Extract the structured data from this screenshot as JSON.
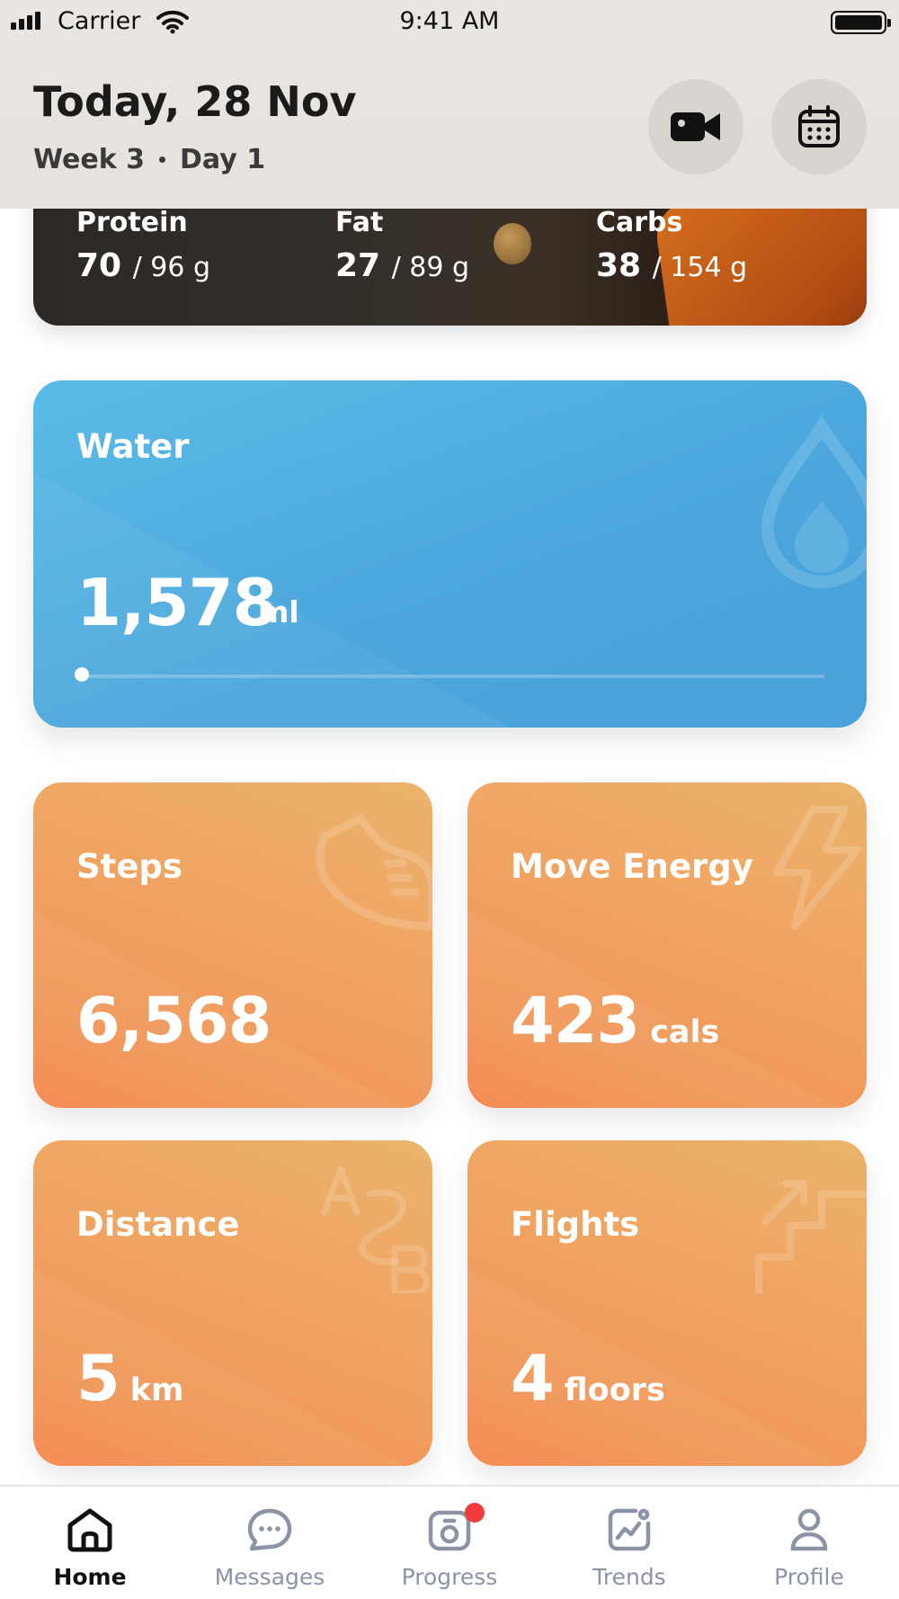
{
  "status_bar": {
    "carrier": "Carrier",
    "time": "9:41 AM",
    "icons": [
      "signal-icon",
      "wifi-icon",
      "battery-icon"
    ]
  },
  "header": {
    "title": "Today, 28 Nov",
    "week": "Week 3",
    "day": "Day 1",
    "buttons": [
      "video-camera-icon",
      "calendar-icon"
    ]
  },
  "macros": [
    {
      "label": "Protein",
      "value": "70",
      "target": "/ 96 g"
    },
    {
      "label": "Fat",
      "value": "27",
      "target": "/ 89 g"
    },
    {
      "label": "Carbs",
      "value": "38",
      "target": "/ 154 g"
    }
  ],
  "water": {
    "label": "Water",
    "value": "1,578",
    "unit": "ml",
    "progress": 0.0,
    "icon": "water-drop-icon"
  },
  "tiles": {
    "steps": {
      "label": "Steps",
      "value": "6,568",
      "unit": "",
      "icon": "sneaker-icon"
    },
    "move_energy": {
      "label": "Move Energy",
      "value": "423",
      "unit": "cals",
      "icon": "lightning-icon"
    },
    "distance": {
      "label": "Distance",
      "value": "5",
      "unit": "km",
      "icon": "a-to-b-icon"
    },
    "flights": {
      "label": "Flights",
      "value": "4",
      "unit": "floors",
      "icon": "stairs-icon"
    }
  },
  "tabbar": {
    "items": [
      {
        "label": "Home",
        "icon": "home-icon",
        "active": true
      },
      {
        "label": "Messages",
        "icon": "chat-bubble-icon",
        "active": false
      },
      {
        "label": "Progress",
        "icon": "camera-icon",
        "active": false,
        "badge": true
      },
      {
        "label": "Trends",
        "icon": "trend-chart-icon",
        "active": false
      },
      {
        "label": "Profile",
        "icon": "user-icon",
        "active": false
      }
    ]
  },
  "colors": {
    "water_card": "#4aa6dc",
    "tile_orange": "#f19558",
    "badge_red": "#f23b3b",
    "inactive_tab": "#8d93a6"
  }
}
